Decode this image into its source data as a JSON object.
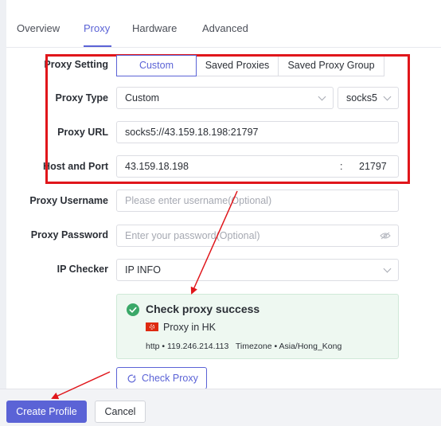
{
  "tabs": [
    {
      "label": "Overview"
    },
    {
      "label": "Proxy"
    },
    {
      "label": "Hardware"
    },
    {
      "label": "Advanced"
    }
  ],
  "proxy_setting": {
    "label": "Proxy Setting",
    "options": [
      "Custom",
      "Saved Proxies",
      "Saved Proxy Group"
    ],
    "selected": "Custom"
  },
  "proxy_type": {
    "label": "Proxy Type",
    "value": "Custom",
    "protocol": "socks5"
  },
  "proxy_url": {
    "label": "Proxy URL",
    "value": "socks5://43.159.18.198:21797"
  },
  "host_port": {
    "label": "Host and Port",
    "host": "43.159.18.198",
    "separator": ":",
    "port": "21797"
  },
  "username": {
    "label": "Proxy Username",
    "placeholder": "Please enter username(Optional)"
  },
  "password": {
    "label": "Proxy Password",
    "placeholder": "Enter your password(Optional)"
  },
  "ip_checker": {
    "label": "IP Checker",
    "value": "IP INFO"
  },
  "check_result": {
    "title": "Check proxy success",
    "location": "Proxy in HK",
    "details": "http • 119.246.214.113   Timezone • Asia/Hong_Kong",
    "status_color": "#3aa868"
  },
  "check_button": {
    "label": "Check Proxy"
  },
  "footer": {
    "create_label": "Create Profile",
    "cancel_label": "Cancel"
  },
  "colors": {
    "accent": "#5b63d6",
    "annotation": "#e0161b"
  }
}
